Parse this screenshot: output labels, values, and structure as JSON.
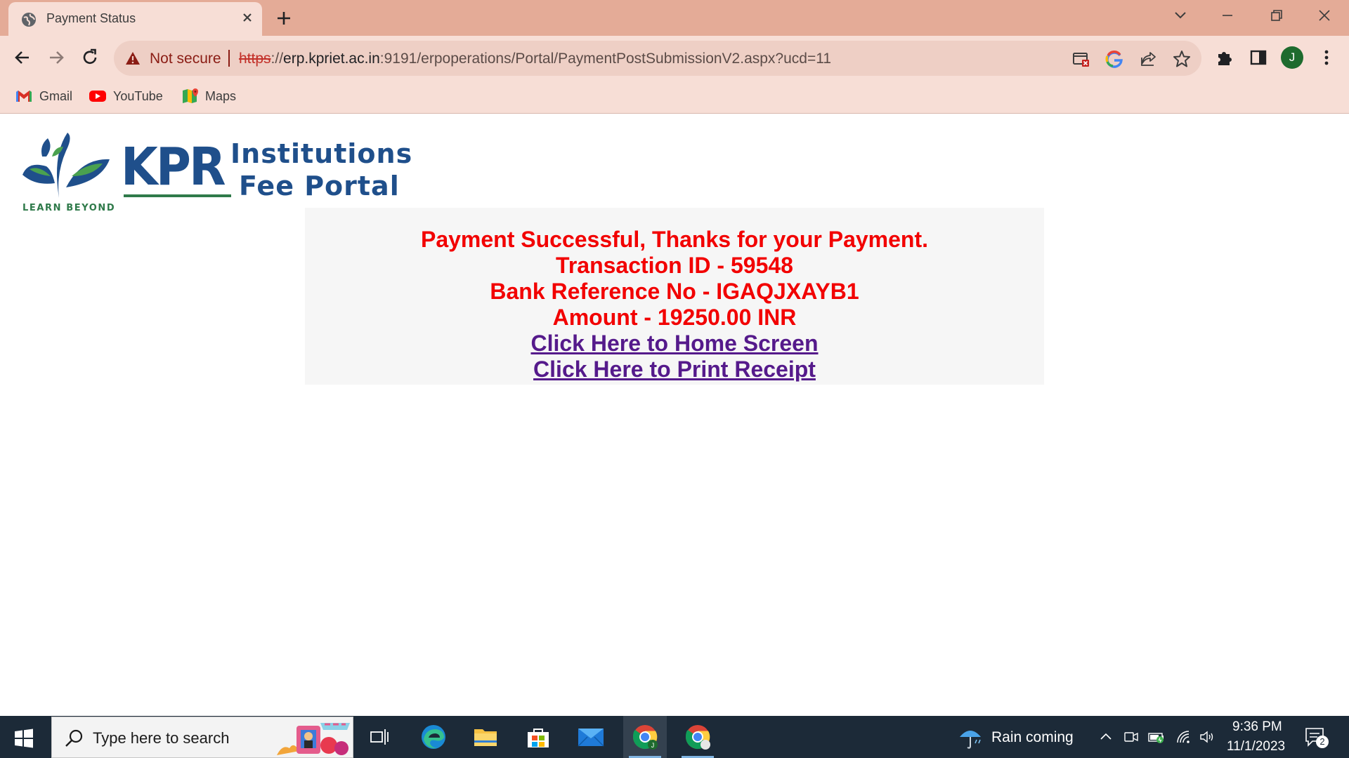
{
  "browser": {
    "tab": {
      "title": "Payment Status"
    },
    "omnibox": {
      "security_label": "Not secure",
      "url_scheme": "https",
      "url_sep": "://",
      "url_host": "erp.kpriet.ac.in",
      "url_rest": ":9191/erpoperations/Portal/PaymentPostSubmissionV2.aspx?ucd=11"
    },
    "profile_initial": "J",
    "bookmarks": [
      {
        "label": "Gmail",
        "icon": "gmail-icon"
      },
      {
        "label": "YouTube",
        "icon": "youtube-icon"
      },
      {
        "label": "Maps",
        "icon": "maps-icon"
      }
    ]
  },
  "page": {
    "logo": {
      "word": "KPR",
      "line1": "Institutions",
      "line2": "Fee Portal",
      "tagline": "LEARN BEYOND"
    },
    "status": {
      "message": "Payment Successful, Thanks for your Payment.",
      "transaction": "Transaction ID - 59548",
      "bank_reference": "Bank Reference No - IGAQJXAYB1",
      "amount": "Amount - 19250.00 INR",
      "home_link": "Click Here to Home Screen",
      "receipt_link": "Click Here to Print Receipt"
    },
    "colors": {
      "status_text": "#f20000",
      "link": "#551a8b",
      "panel": "#f6f6f6"
    }
  },
  "taskbar": {
    "search_placeholder": "Type here to search",
    "weather": "Rain coming",
    "time": "9:36 PM",
    "date": "11/1/2023",
    "notification_count": "2"
  }
}
